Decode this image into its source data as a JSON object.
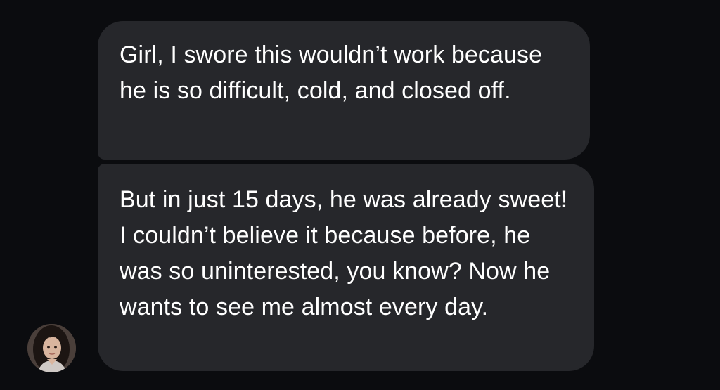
{
  "conversation": {
    "messages": [
      {
        "sender": "contact",
        "text": "Girl, I swore this wouldn’t work because he is so difficult, cold, and closed off."
      },
      {
        "sender": "contact",
        "text": "But in just 15 days, he was already sweet! I couldn’t believe it because before, he was so uninterested, you know? Now he wants to see me almost every day."
      }
    ],
    "avatar": {
      "icon": "contact-avatar-photo"
    }
  },
  "colors": {
    "background": "#0b0c0f",
    "bubble": "#26272b",
    "text": "#ffffff"
  }
}
